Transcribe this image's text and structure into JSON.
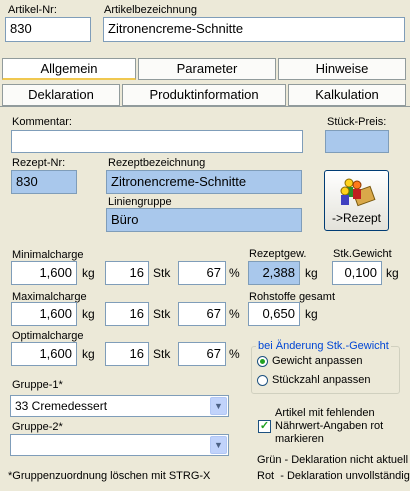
{
  "header": {
    "artikel_nr_label": "Artikel-Nr:",
    "artikel_nr": "830",
    "bezeichnung_label": "Artikelbezeichnung",
    "bezeichnung": "Zitronencreme-Schnitte"
  },
  "tabs_row1": [
    "Allgemein",
    "Parameter",
    "Hinweise"
  ],
  "tabs_row2": [
    "Deklaration",
    "Produktinformation",
    "Kalkulation"
  ],
  "kommentar_label": "Kommentar:",
  "kommentar": "",
  "stueckpreis_label": "Stück-Preis:",
  "stueckpreis": "",
  "rezept_nr_label": "Rezept-Nr:",
  "rezept_nr": "830",
  "rezeptbez_label": "Rezeptbezeichnung",
  "rezeptbez": "Zitronencreme-Schnitte",
  "liniengruppe_label": "Liniengruppe",
  "liniengruppe": "Büro",
  "rezept_button": "->Rezept",
  "charges": [
    {
      "label": "Minimalcharge",
      "kg": "1,600",
      "stk": "16",
      "pct": "67"
    },
    {
      "label": "Maximalcharge",
      "kg": "1,600",
      "stk": "16",
      "pct": "67"
    },
    {
      "label": "Optimalcharge",
      "kg": "1,600",
      "stk": "16",
      "pct": "67"
    }
  ],
  "units": {
    "kg": "kg",
    "stk": "Stk",
    "pct": "%"
  },
  "rezeptgew_label": "Rezeptgew.",
  "rezeptgew": "2,388",
  "stkgewicht_label": "Stk.Gewicht",
  "stkgewicht": "0,100",
  "rohstoffe_label": "Rohstoffe gesamt",
  "rohstoffe": "0,650",
  "aenderung_group_label": "bei Änderung Stk.-Gewicht",
  "radio_gewicht": "Gewicht anpassen",
  "radio_stueckzahl": "Stückzahl anpassen",
  "gruppe1_label": "Gruppe-1*",
  "gruppe1": "33 Cremedessert",
  "gruppe2_label": "Gruppe-2*",
  "gruppe2": "",
  "checkbox_text_1": "Artikel mit fehlenden",
  "checkbox_text_2": "Nährwert-Angaben rot",
  "checkbox_text_3": "markieren",
  "footnote": "*Gruppenzuordnung löschen mit STRG-X",
  "legend_gruen": "Grün - Deklaration nicht aktuell",
  "legend_rot": "Rot  - Deklaration unvollständig"
}
